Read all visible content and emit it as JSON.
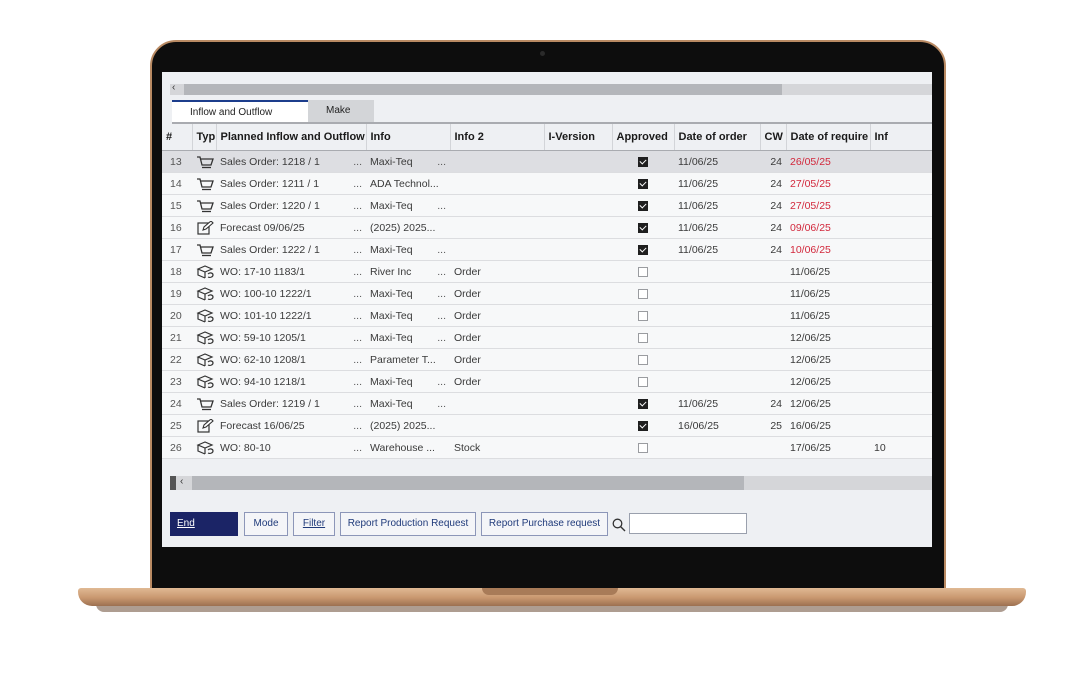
{
  "tabs": [
    {
      "label": "Inflow and Outflow",
      "active": true
    },
    {
      "label": "Make",
      "active": false
    }
  ],
  "columns": [
    "#",
    "Typ",
    "Planned Inflow and Outflow",
    "Info",
    "Info 2",
    "I-Version",
    "Approved",
    "Date of order",
    "CW",
    "Date of require",
    "Inf"
  ],
  "rows": [
    {
      "n": "13",
      "icon": "cart-icon",
      "planned": "Sales Order: 1218 / 1",
      "info": "Maxi-Teq",
      "info_dots": "...",
      "info2": "",
      "approved": true,
      "order_date": "11/06/25",
      "cw": "24",
      "req_date": "26/05/25",
      "req_red": true,
      "inf": "",
      "selected": true
    },
    {
      "n": "14",
      "icon": "cart-icon",
      "planned": "Sales Order: 1211 / 1",
      "info": "ADA Technol...",
      "info_dots": "",
      "info2": "",
      "approved": true,
      "order_date": "11/06/25",
      "cw": "24",
      "req_date": "27/05/25",
      "req_red": true,
      "inf": ""
    },
    {
      "n": "15",
      "icon": "cart-icon",
      "planned": "Sales Order: 1220 / 1",
      "info": "Maxi-Teq",
      "info_dots": "...",
      "info2": "",
      "approved": true,
      "order_date": "11/06/25",
      "cw": "24",
      "req_date": "27/05/25",
      "req_red": true,
      "inf": ""
    },
    {
      "n": "16",
      "icon": "edit-icon",
      "planned": "Forecast 09/06/25",
      "info": "(2025) 2025...",
      "info_dots": "",
      "info2": "",
      "approved": true,
      "order_date": "11/06/25",
      "cw": "24",
      "req_date": "09/06/25",
      "req_red": true,
      "inf": ""
    },
    {
      "n": "17",
      "icon": "cart-icon",
      "planned": "Sales Order: 1222 / 1",
      "info": "Maxi-Teq",
      "info_dots": "...",
      "info2": "",
      "approved": true,
      "order_date": "11/06/25",
      "cw": "24",
      "req_date": "10/06/25",
      "req_red": true,
      "inf": ""
    },
    {
      "n": "18",
      "icon": "box-icon",
      "planned": "WO: 17-10 1183/1",
      "info": "River Inc",
      "info_dots": "...",
      "info2": "Order",
      "approved": false,
      "order_date": "",
      "cw": "",
      "req_date": "11/06/25",
      "req_red": false,
      "inf": ""
    },
    {
      "n": "19",
      "icon": "box-icon",
      "planned": "WO: 100-10 1222/1",
      "info": "Maxi-Teq",
      "info_dots": "...",
      "info2": "Order",
      "approved": false,
      "order_date": "",
      "cw": "",
      "req_date": "11/06/25",
      "req_red": false,
      "inf": ""
    },
    {
      "n": "20",
      "icon": "box-icon",
      "planned": "WO: 101-10 1222/1",
      "info": "Maxi-Teq",
      "info_dots": "...",
      "info2": "Order",
      "approved": false,
      "order_date": "",
      "cw": "",
      "req_date": "11/06/25",
      "req_red": false,
      "inf": ""
    },
    {
      "n": "21",
      "icon": "box-icon",
      "planned": "WO: 59-10 1205/1",
      "info": "Maxi-Teq",
      "info_dots": "...",
      "info2": "Order",
      "approved": false,
      "order_date": "",
      "cw": "",
      "req_date": "12/06/25",
      "req_red": false,
      "inf": ""
    },
    {
      "n": "22",
      "icon": "box-icon",
      "planned": "WO: 62-10 1208/1",
      "info": "Parameter T...",
      "info_dots": "",
      "info2": "Order",
      "approved": false,
      "order_date": "",
      "cw": "",
      "req_date": "12/06/25",
      "req_red": false,
      "inf": ""
    },
    {
      "n": "23",
      "icon": "box-icon",
      "planned": "WO: 94-10 1218/1",
      "info": "Maxi-Teq",
      "info_dots": "...",
      "info2": "Order",
      "approved": false,
      "order_date": "",
      "cw": "",
      "req_date": "12/06/25",
      "req_red": false,
      "inf": ""
    },
    {
      "n": "24",
      "icon": "cart-icon",
      "planned": "Sales Order: 1219 / 1",
      "info": "Maxi-Teq",
      "info_dots": "...",
      "info2": "",
      "approved": true,
      "order_date": "11/06/25",
      "cw": "24",
      "req_date": "12/06/25",
      "req_red": false,
      "inf": ""
    },
    {
      "n": "25",
      "icon": "edit-icon",
      "planned": "Forecast 16/06/25",
      "info": "(2025) 2025...",
      "info_dots": "",
      "info2": "",
      "approved": true,
      "order_date": "16/06/25",
      "cw": "25",
      "req_date": "16/06/25",
      "req_red": false,
      "inf": ""
    },
    {
      "n": "26",
      "icon": "box-icon",
      "planned": "WO: 80-10",
      "info": "Warehouse ...",
      "info_dots": "",
      "info2": "Stock",
      "approved": false,
      "order_date": "",
      "cw": "",
      "req_date": "17/06/25",
      "req_red": false,
      "inf": "10"
    }
  ],
  "planned_dots": "...",
  "buttons": {
    "end": "End",
    "mode": "Mode",
    "filter": "Filter",
    "report_production": "Report Production Request",
    "report_purchase": "Report Purchase request"
  },
  "search": {
    "value": "",
    "placeholder": ""
  },
  "colors": {
    "primary_button": "#1b2466",
    "overdue_date": "#d2283c",
    "active_tab_border": "#1c3d8c"
  }
}
